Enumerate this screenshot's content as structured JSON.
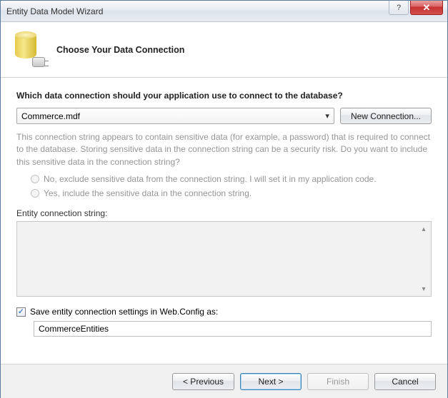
{
  "window": {
    "title": "Entity Data Model Wizard"
  },
  "header": {
    "title": "Choose Your Data Connection"
  },
  "main": {
    "question": "Which data connection should your application use to connect to the database?",
    "selected_connection": "Commerce.mdf",
    "new_connection_label": "New Connection...",
    "sensitive_warning": "This connection string appears to contain sensitive data (for example, a password) that is required to connect to the database. Storing sensitive data in the connection string can be a security risk. Do you want to include this sensitive data in the connection string?",
    "radio_exclude": "No, exclude sensitive data from the connection string. I will set it in my application code.",
    "radio_include": "Yes, include the sensitive data in the connection string.",
    "conn_string_label": "Entity connection string:",
    "conn_string_value": "",
    "save_checkbox_label": "Save entity connection settings in Web.Config as:",
    "save_checkbox_checked": true,
    "settings_name": "CommerceEntities"
  },
  "footer": {
    "previous": "< Previous",
    "next": "Next >",
    "finish": "Finish",
    "cancel": "Cancel"
  }
}
